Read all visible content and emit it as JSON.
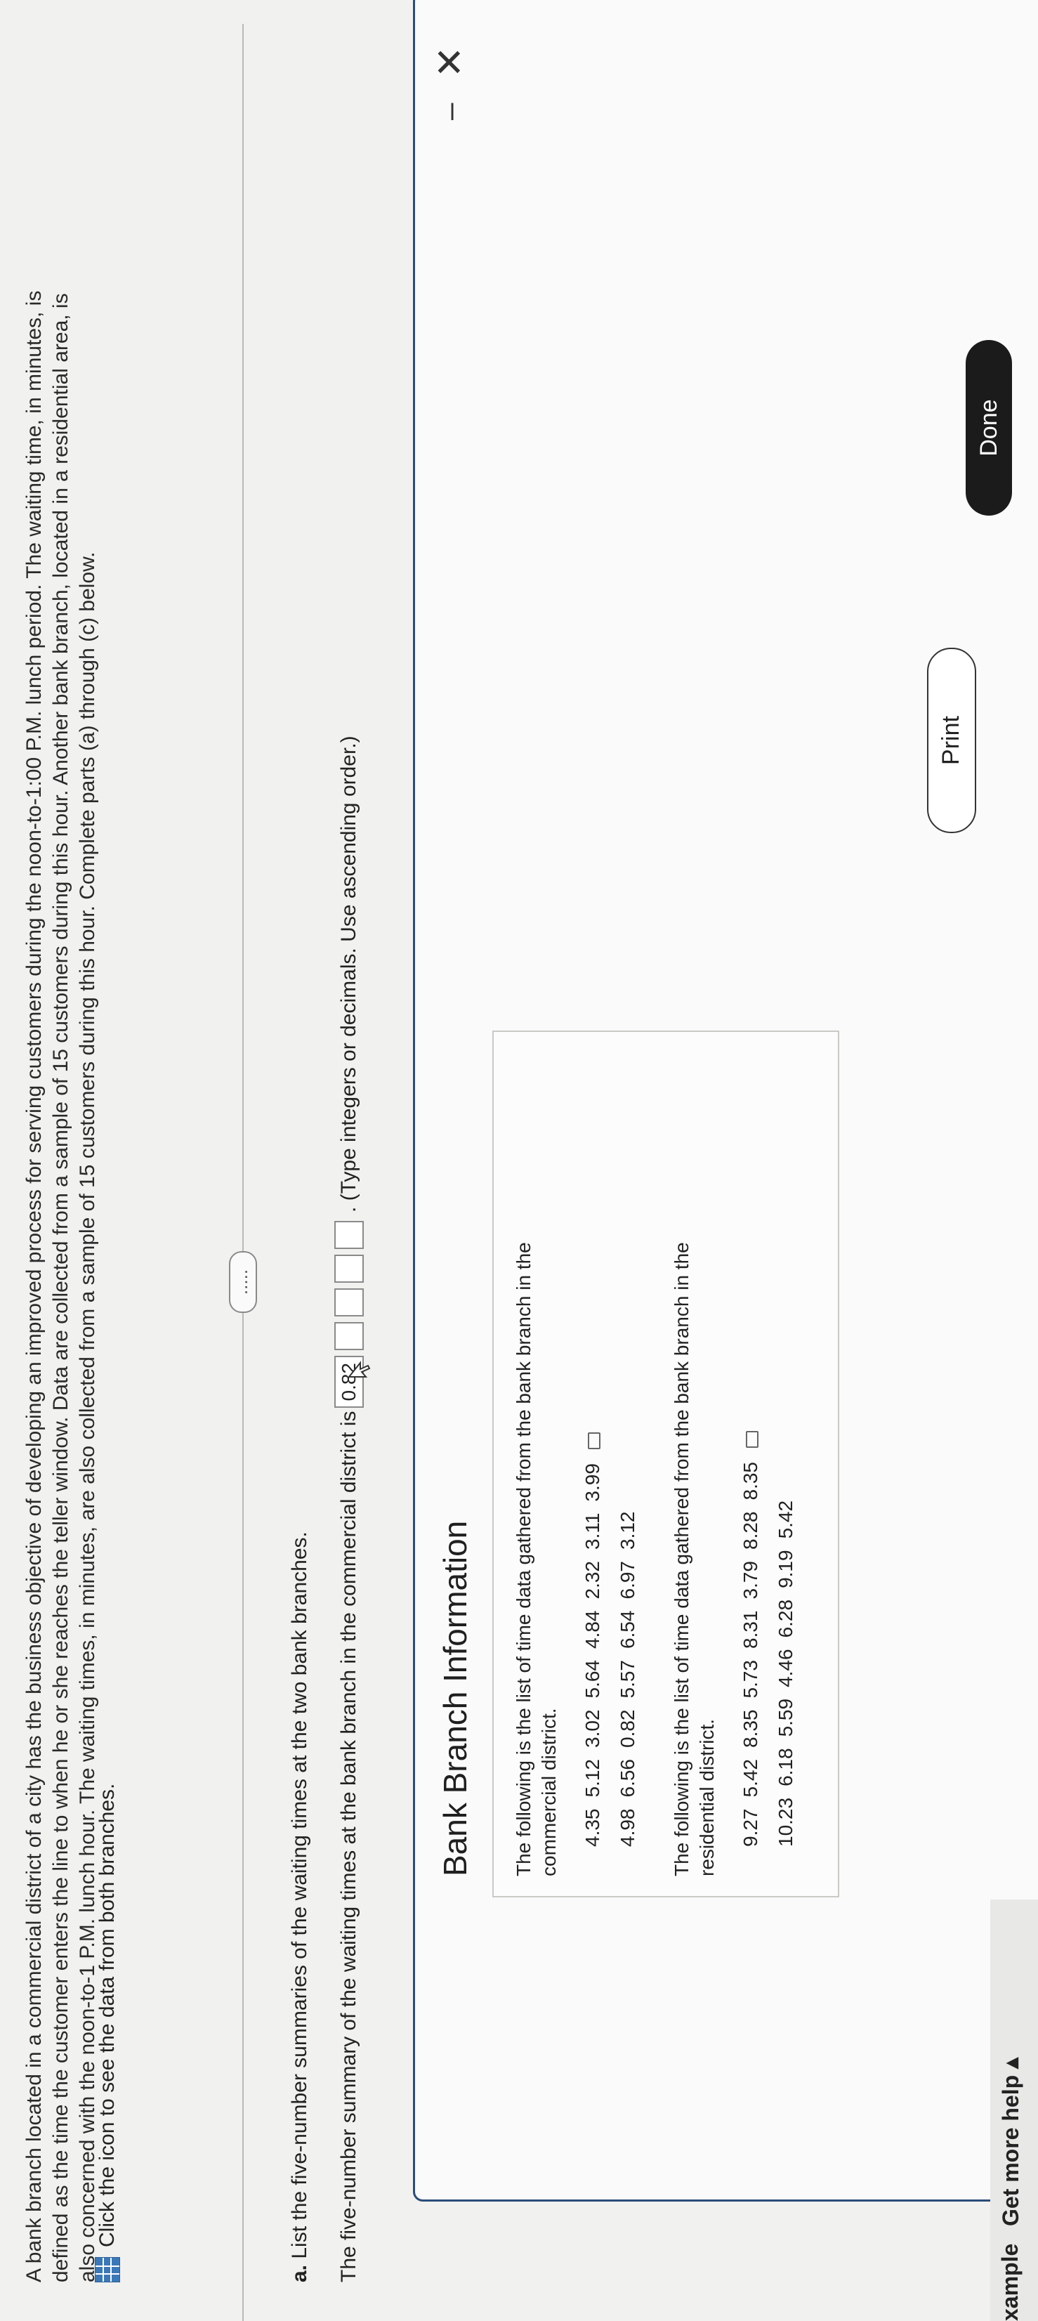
{
  "problem": {
    "line1": "A bank branch located in a commercial district of a city has the business objective of developing an improved process for serving customers during the noon-to-1:00 P.M. lunch period. The waiting time, in minutes, is",
    "line2": "defined as the time the customer enters the line to when he or she reaches the teller window. Data are collected from a sample of 15 customers during this hour. Another bank branch, located in a residential area, is",
    "line3": "also concerned with the noon-to-1 P.M. lunch hour. The waiting times, in minutes, are also collected from a sample of 15 customers during this hour. Complete parts (a) through (c) below.",
    "data_link": "Click the icon to see the data from both branches.",
    "more_button": "....."
  },
  "part_a": {
    "label": "a.",
    "text": "List the five-number summaries of the waiting times at the two bank branches.",
    "summary_prefix": "The five-number summary of the waiting times at the bank branch in the commercial district is",
    "answer_values": [
      "0.82",
      "",
      "",
      "",
      ""
    ],
    "hint": ". (Type integers or decimals. Use ascending order.)"
  },
  "panel": {
    "title": "Bank Branch Information",
    "minimize": "–",
    "close": "✕",
    "commercial_intro_1": "The following is the list of time data gathered from the bank branch in the",
    "commercial_intro_2": "commercial district.",
    "commercial_row1": [
      "4.35",
      "5.12",
      "3.02",
      "5.64",
      "4.84",
      "2.32",
      "3.11",
      "3.99"
    ],
    "commercial_row2": [
      "4.98",
      "6.56",
      "0.82",
      "5.57",
      "6.54",
      "6.97",
      "3.12"
    ],
    "residential_intro_1": "The following is the list of time data gathered from the bank branch in the",
    "residential_intro_2": "residential district.",
    "residential_row1": [
      "9.27",
      "5.42",
      "8.35",
      "5.73",
      "8.31",
      "3.79",
      "8.28",
      "8.35"
    ],
    "residential_row2": [
      "10.23",
      "6.18",
      "5.59",
      "4.46",
      "6.28",
      "9.19",
      "5.42"
    ],
    "print_button": "Print",
    "done_button": "Done"
  },
  "footer": {
    "example": "xample",
    "get_more_help": "Get more help ▴"
  },
  "colors": {
    "panel_border": "#2a4d79",
    "done_bg": "#1b1b1b",
    "icon_blue": "#3a78b8"
  },
  "icons": [
    "grid-icon",
    "cursor-arrow-icon",
    "copy-icon",
    "minimize-icon",
    "close-icon"
  ]
}
